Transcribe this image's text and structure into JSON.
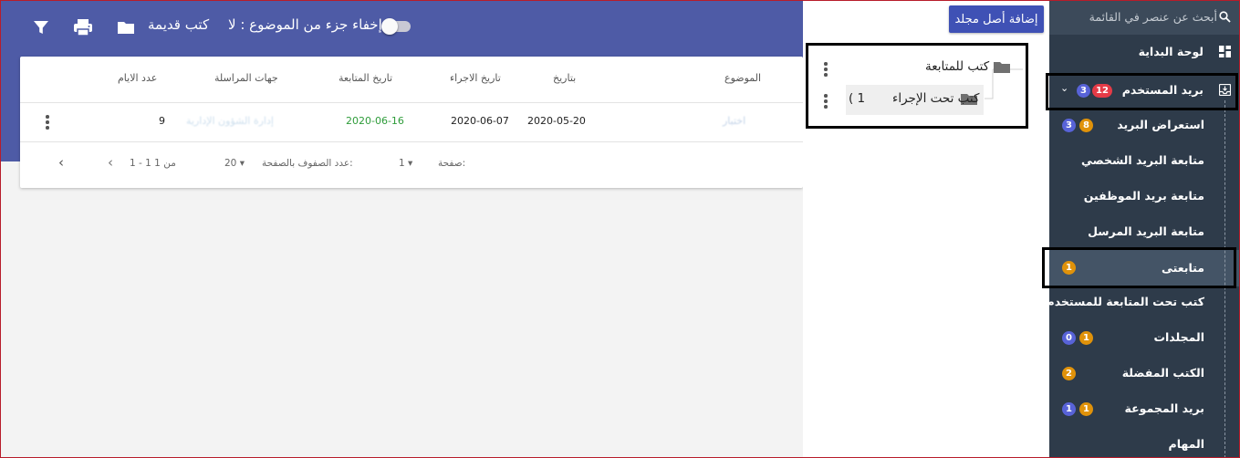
{
  "toolbar": {
    "filter_icon": "filter-icon",
    "print_icon": "print-icon",
    "folder_icon": "folder-icon",
    "old_books_label": "كتب قديمة",
    "hide_toggle_label": "إخفاء جزء من الموضوع : لا"
  },
  "table": {
    "headers": {
      "subject": "الموضوع",
      "date": "بتاريخ",
      "action_date": "تاريخ الاجراء",
      "followup_date": "تاريخ المتابعة",
      "correspondents": "جهات المراسلة",
      "days": "عدد الايام"
    },
    "row": {
      "subject": "اختبار",
      "date": "2020-05-20",
      "action_date": "2020-06-07",
      "followup_date": "2020-06-16",
      "correspondents": "إدارة الشؤون الإدارية",
      "days": "9"
    },
    "footer": {
      "page_label": "صفحة:",
      "page_value": "1",
      "rows_per_page_label": "عدد الصفوف بالصفحة:",
      "rows_per_page_value": "20",
      "range": "1 - 1 من 1"
    }
  },
  "tree": {
    "add_root_label": "إضافة أصل مجلد",
    "nodes": [
      {
        "label": "كتب للمتابعة"
      },
      {
        "label": "كتب تحت الإجراء",
        "count": "( 1"
      }
    ]
  },
  "sidebar": {
    "search_placeholder": "أبحث عن عنصر في القائمة",
    "items": [
      {
        "label": "لوحة البداية",
        "icon": "dashboard-icon"
      },
      {
        "label": "بريد المستخدم",
        "badges": [
          "12",
          "3"
        ],
        "icon": "inbox-icon"
      },
      {
        "label": "استعراض البريد",
        "badges": [
          "8",
          "3"
        ]
      },
      {
        "label": "متابعة البريد الشخصي"
      },
      {
        "label": "متابعة بريد الموظفين"
      },
      {
        "label": "متابعة البريد المرسل"
      },
      {
        "label": "متابعتى",
        "badges": [
          "1"
        ]
      },
      {
        "label": "كتب تحت المتابعة للمستخدم"
      },
      {
        "label": "المجلدات",
        "badges": [
          "1",
          "0"
        ]
      },
      {
        "label": "الكتب المفضلة",
        "badges": [
          "2"
        ]
      },
      {
        "label": "بريد المجموعة",
        "badges": [
          "1",
          "1"
        ]
      },
      {
        "label": "المهام"
      }
    ]
  },
  "colors": {
    "banner": "#4e5ba6",
    "sidebar": "#2e3b4a",
    "accent": "#3f51b5",
    "green_date": "#2e9c3a",
    "badge_blue": "#5863d8",
    "badge_red": "#e53b47",
    "badge_orange": "#e0920a"
  }
}
